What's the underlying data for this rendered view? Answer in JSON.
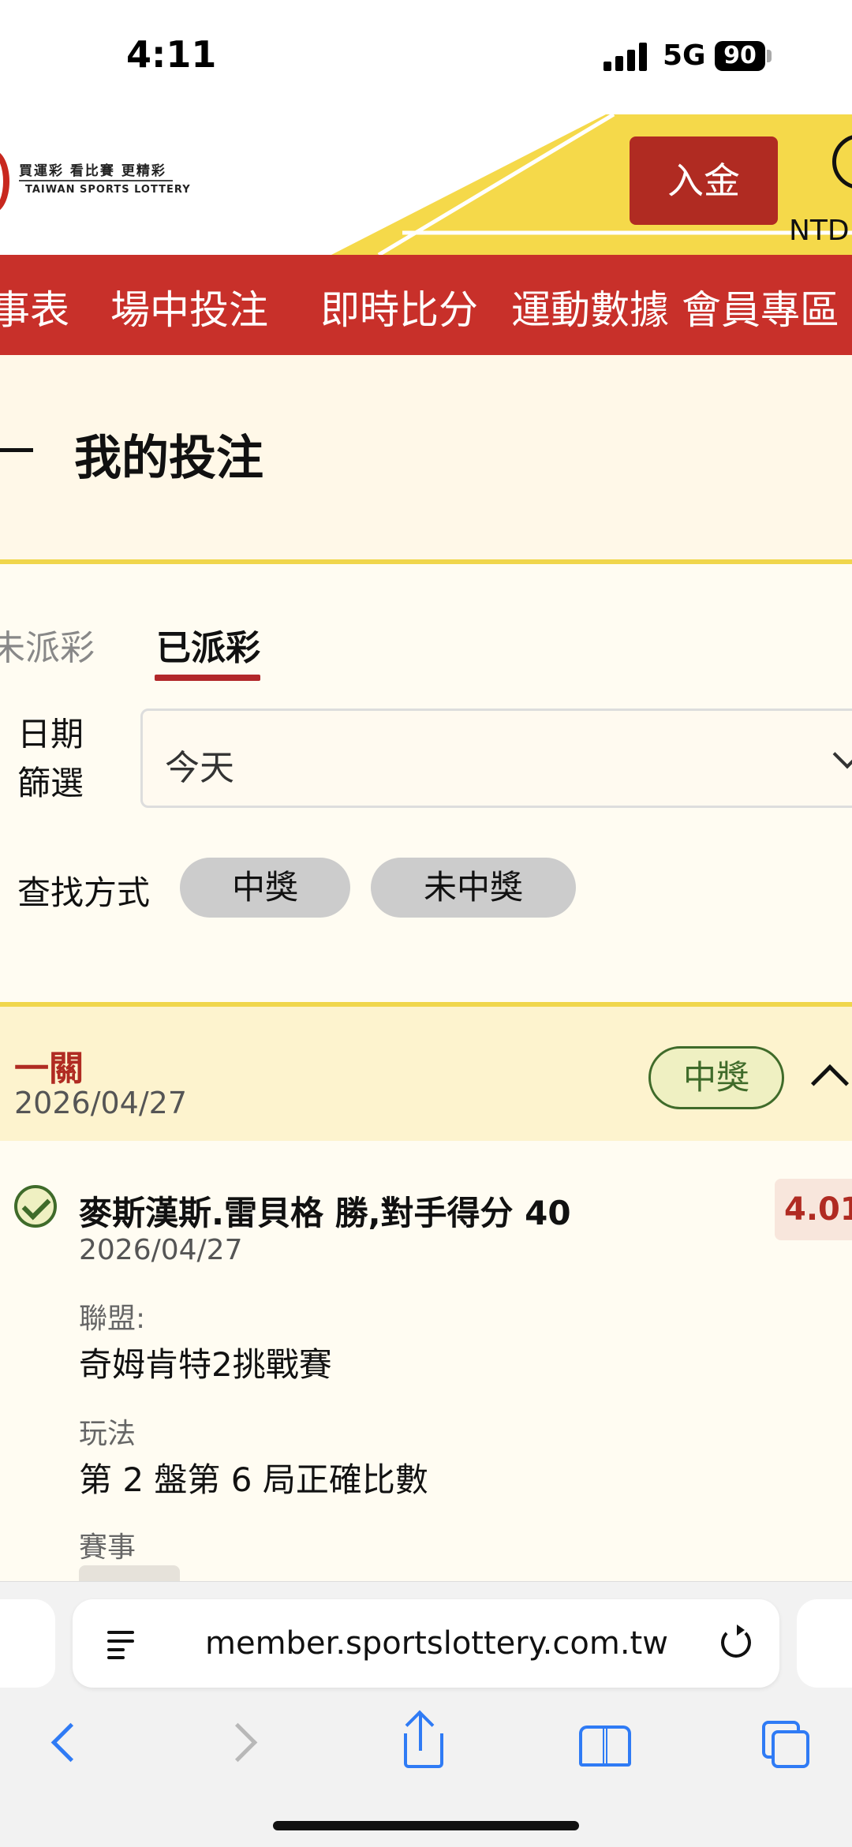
{
  "status_bar": {
    "time": "4:11",
    "network": "5G",
    "battery": "90"
  },
  "header": {
    "logo_tagline": "買運彩 看比賽 更精彩",
    "logo_en": "TAIWAN SPORTS LOTTERY",
    "deposit_label": "入金",
    "currency": "NTD"
  },
  "nav": {
    "items": [
      "事表",
      "場中投注",
      "即時比分",
      "運動數據",
      "會員專區"
    ]
  },
  "page": {
    "title": "我的投注"
  },
  "tabs": {
    "unpaid": "未派彩",
    "paid": "已派彩"
  },
  "filter": {
    "date_label": "日期篩選",
    "date_line1": "日期",
    "date_line2": "篩選",
    "date_value": "今天"
  },
  "search": {
    "label": "查找方式",
    "won": "中獎",
    "lost": "未中獎"
  },
  "bet": {
    "type": "一關",
    "date": "2026/04/27",
    "status": "中獎",
    "selection": "麥斯漢斯.雷貝格 勝,對手得分 40",
    "odds": "4.01",
    "selection_date": "2026/04/27",
    "league_label": "聯盟:",
    "league_value": "奇姆肯特2挑戰賽",
    "market_label": "玩法",
    "market_value": "第 2 盤第 6 局正確比數",
    "event_label": "賽事"
  },
  "browser": {
    "url": "member.sportslottery.com.tw"
  }
}
